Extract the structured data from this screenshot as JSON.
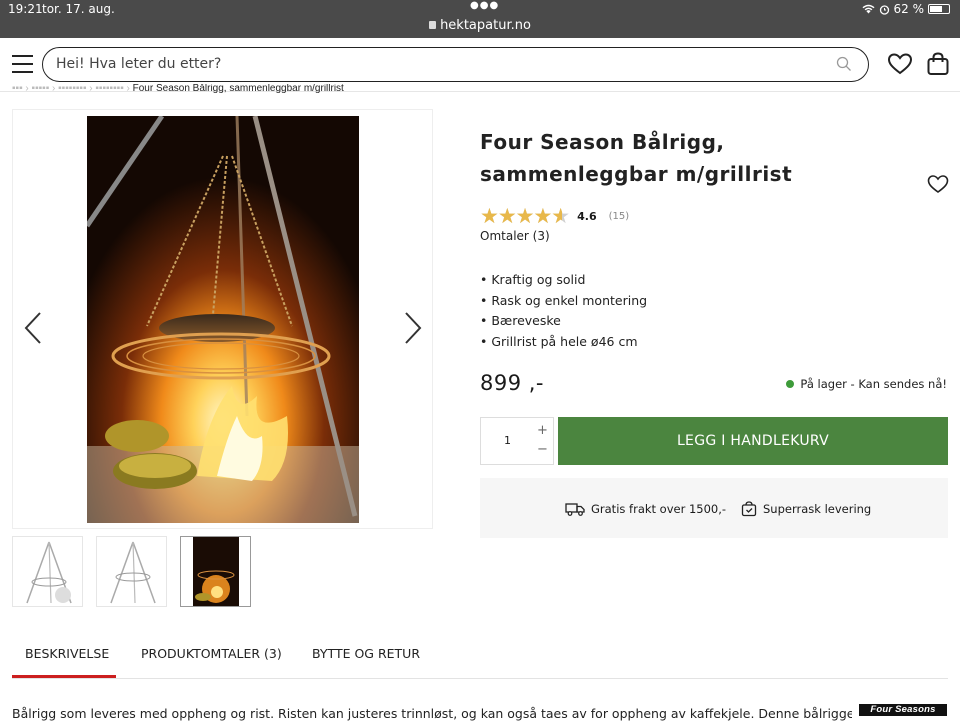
{
  "status_bar": {
    "time": "19:21",
    "date": "tor. 17. aug.",
    "url": "hektapatur.no",
    "battery": "62 %"
  },
  "header": {
    "search_placeholder": "Hei! Hva leter du etter?",
    "icons": [
      "menu-icon",
      "search-icon",
      "heart-icon",
      "shopping-bag-icon"
    ]
  },
  "breadcrumb": {
    "current": "Four Season Bålrigg, sammenleggbar m/grillrist"
  },
  "product": {
    "title": "Four Season Bålrigg, sammenleggbar m/grillrist",
    "rating": 4.6,
    "rating_text": "4.6",
    "rating_count": "(15)",
    "reviews_link": "Omtaler (3)",
    "features": [
      "Kraftig og solid",
      "Rask og enkel montering",
      "Bæreveske",
      "Grillrist på hele ø46 cm"
    ],
    "price": "899 ,-",
    "stock": "På lager - Kan sendes nå!",
    "quantity": "1",
    "add_to_cart": "LEGG I HANDLEKURV",
    "usp": {
      "shipping": "Gratis frakt over 1500,-",
      "delivery": "Superrask levering"
    }
  },
  "tabs": [
    {
      "label": "BESKRIVELSE",
      "active": true
    },
    {
      "label": "PRODUKTOMTALER (3)",
      "active": false
    },
    {
      "label": "BYTTE OG RETUR",
      "active": false
    }
  ],
  "description": "Bålrigg som leveres med oppheng og rist. Risten kan justeres trinnløst, og kan også taes av for oppheng av kaffekjele. Denne bålriggen ble",
  "brand_logo": "Four Seasons",
  "colors": {
    "accent_green": "#4b853f",
    "tab_underline": "#cc1f1f",
    "star": "#e8b84a"
  }
}
